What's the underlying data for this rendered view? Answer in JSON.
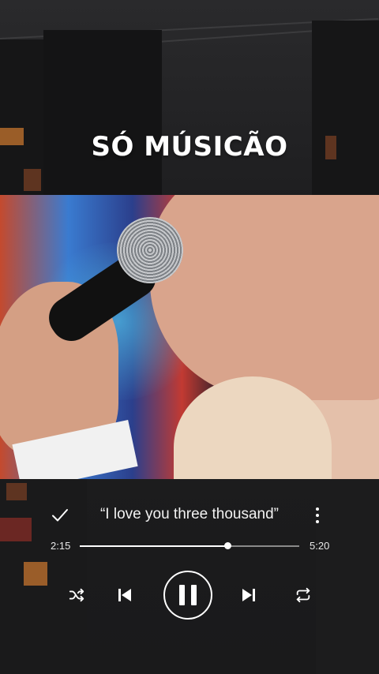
{
  "overlay": {
    "title": "SÓ MÚSICÃO"
  },
  "player": {
    "song_title": "“I love you three thousand”",
    "current_time": "2:15",
    "total_time": "5:20",
    "progress": 0.675,
    "icons": {
      "like": "check-icon",
      "menu": "more-vertical-icon",
      "shuffle": "shuffle-icon",
      "previous": "skip-previous-icon",
      "play_pause": "pause-icon",
      "next": "skip-next-icon",
      "repeat": "repeat-icon"
    }
  },
  "colors": {
    "background": "#1b1b1d",
    "text": "#ffffff",
    "track": "#8a8a8a"
  }
}
